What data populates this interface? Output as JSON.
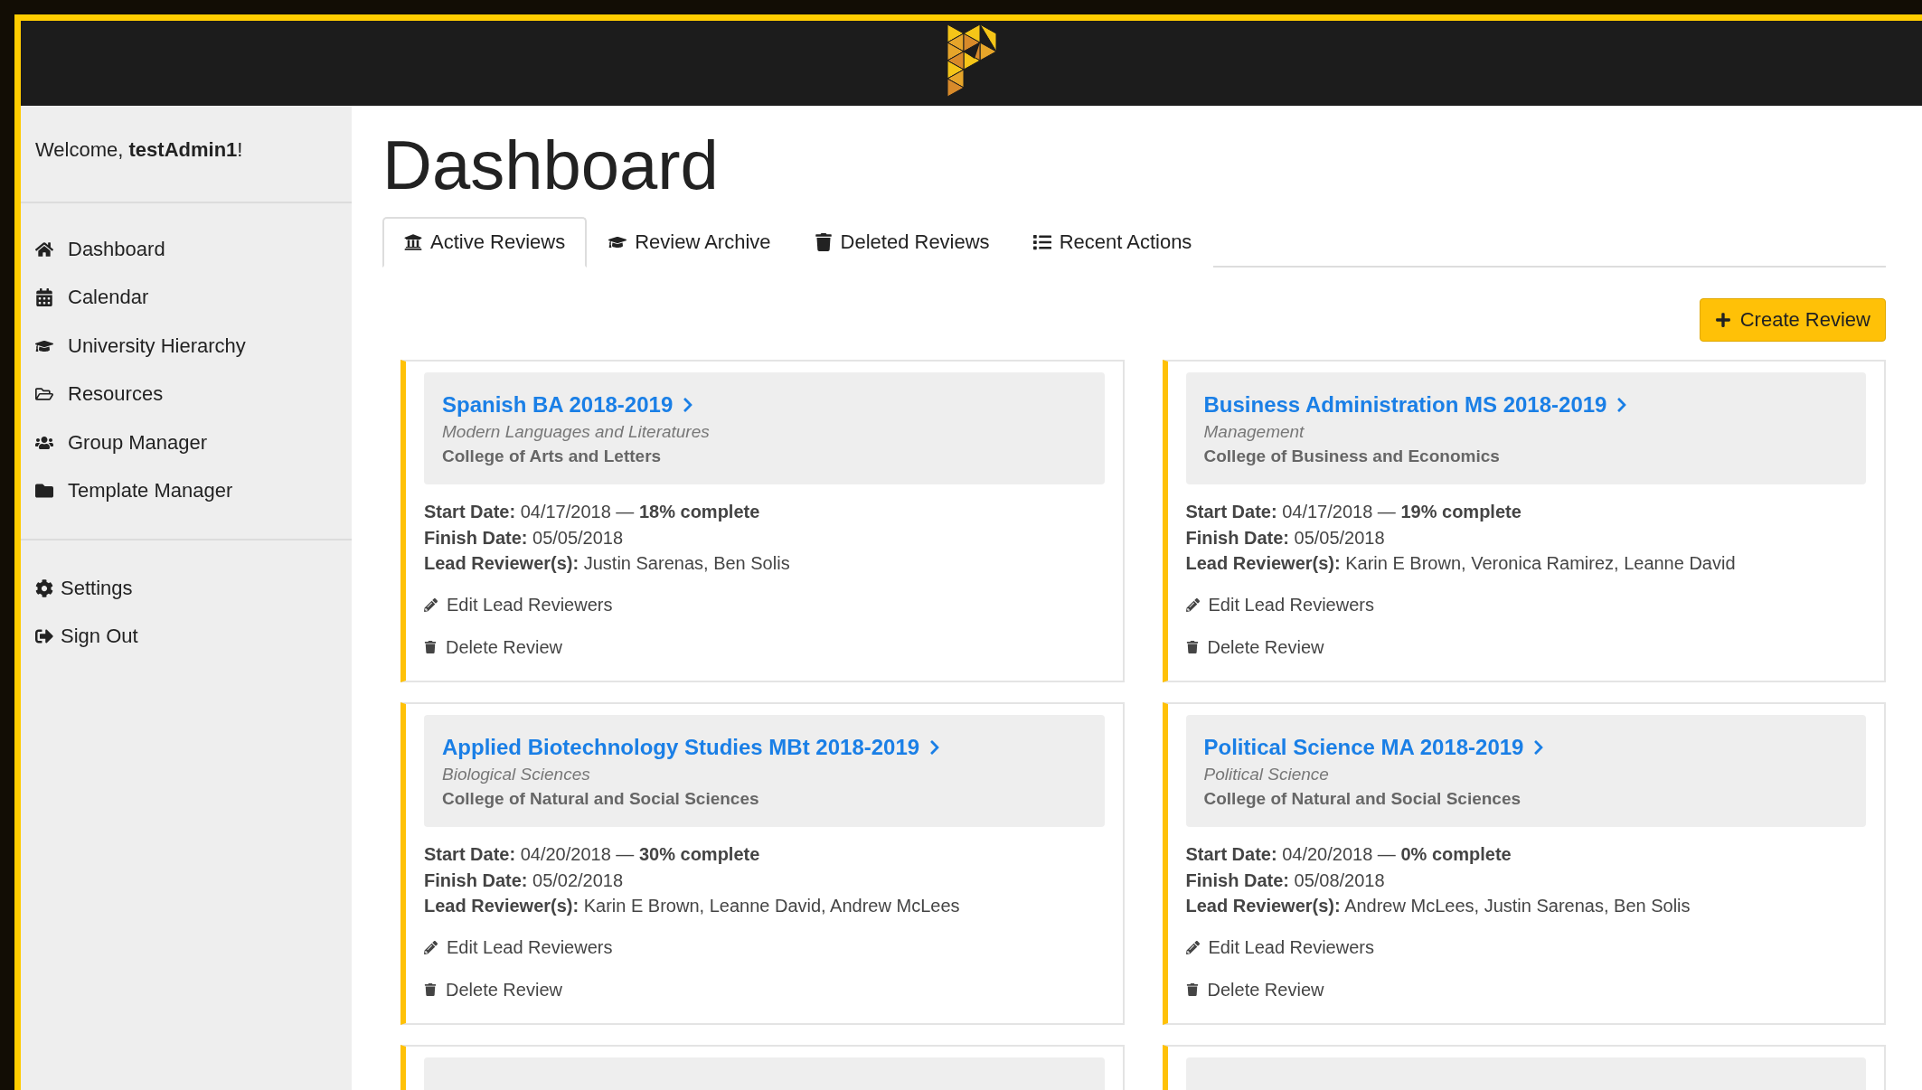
{
  "welcome": "Welcome, **testAdmin1**!",
  "sidebar": {
    "items": [
      {
        "label": "Dashboard"
      },
      {
        "label": "Calendar"
      },
      {
        "label": "University Hierarchy"
      },
      {
        "label": "Resources"
      },
      {
        "label": "Group Manager"
      },
      {
        "label": "Template Manager"
      }
    ],
    "footer_items": [
      {
        "label": "Settings"
      },
      {
        "label": "Sign Out"
      }
    ]
  },
  "page_title": "Dashboard",
  "tabs": [
    {
      "label": "Active Reviews",
      "selected": true
    },
    {
      "label": "Review Archive",
      "selected": false
    },
    {
      "label": "Deleted Reviews",
      "selected": false
    },
    {
      "label": "Recent Actions",
      "selected": false
    }
  ],
  "create_button": "Create Review",
  "reviews": [
    {
      "kind": "full",
      "title": "Spanish BA 2018-2019",
      "department": "Modern Languages and Literatures",
      "college": "College of Arts and Letters",
      "start": "**Start Date:** 04/17/2018 — **18% complete**",
      "finish": "**Finish Date:** 05/05/2018",
      "leads": "**Lead Reviewer(s):** Justin Sarenas, Ben Solis",
      "edit_action": "Edit Lead Reviewers",
      "delete_action": "Delete Review"
    },
    {
      "kind": "full",
      "title": "Business Administration MS 2018-2019",
      "department": "Management",
      "college": "College of Business and Economics",
      "start": "**Start Date:** 04/17/2018 — **19% complete**",
      "finish": "**Finish Date:** 05/05/2018",
      "leads": "**Lead Reviewer(s):** Karin E Brown, Veronica Ramirez, Leanne David",
      "edit_action": "Edit Lead Reviewers",
      "delete_action": "Delete Review"
    },
    {
      "kind": "full",
      "title": "Applied Biotechnology Studies MBt 2018-2019",
      "department": "Biological Sciences",
      "college": "College of Natural and Social Sciences",
      "start": "**Start Date:** 04/20/2018 — **30% complete**",
      "finish": "**Finish Date:** 05/02/2018",
      "leads": "**Lead Reviewer(s):** Karin E Brown, Leanne David, Andrew McLees",
      "edit_action": "Edit Lead Reviewers",
      "delete_action": "Delete Review"
    },
    {
      "kind": "full",
      "title": "Political Science MA 2018-2019",
      "department": "Political Science",
      "college": "College of Natural and Social Sciences",
      "start": "**Start Date:** 04/20/2018 — **0% complete**",
      "finish": "**Finish Date:** 05/08/2018",
      "leads": "**Lead Reviewer(s):** Andrew McLees, Justin Sarenas, Ben Solis",
      "edit_action": "Edit Lead Reviewers",
      "delete_action": "Delete Review"
    },
    {
      "kind": "cut"
    },
    {
      "kind": "cut"
    }
  ]
}
